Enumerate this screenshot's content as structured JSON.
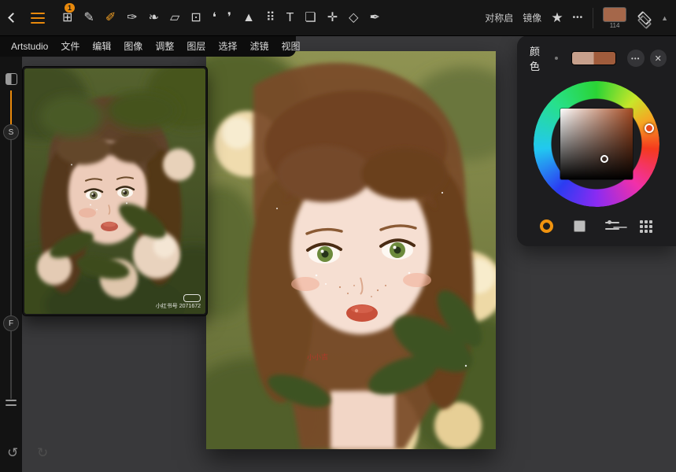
{
  "topbar": {
    "menu_badge": "1",
    "tools": [
      {
        "name": "tools-grid-icon",
        "glyph": "⊞"
      },
      {
        "name": "pencil-set-icon",
        "glyph": "✎"
      },
      {
        "name": "paint-brush-icon",
        "glyph": "✐",
        "active": "true"
      },
      {
        "name": "palette-knife-icon",
        "glyph": "✑"
      },
      {
        "name": "wet-brush-icon",
        "glyph": "❧"
      },
      {
        "name": "eraser-icon",
        "glyph": "▱"
      },
      {
        "name": "crop-icon",
        "glyph": "⊡"
      },
      {
        "name": "water-drop-icon",
        "glyph": "❛"
      },
      {
        "name": "smudge-icon",
        "glyph": "❜"
      },
      {
        "name": "shape-icon",
        "glyph": "▲"
      },
      {
        "name": "airbrush-icon",
        "glyph": "⠿"
      },
      {
        "name": "text-icon",
        "glyph": "T"
      },
      {
        "name": "speech-bubble-icon",
        "glyph": "❏"
      },
      {
        "name": "transform-icon",
        "glyph": "✛"
      },
      {
        "name": "lasso-icon",
        "glyph": "◇"
      },
      {
        "name": "eyedropper-icon",
        "glyph": "✒"
      }
    ],
    "symmetry_label": "对称启",
    "mirror_label": "镜像",
    "swatch_value": "114",
    "swatch_color": "#a5674a"
  },
  "icons": {
    "star": "★",
    "more": "•••",
    "collapse": "▲",
    "undo": "↺",
    "redo": "↻",
    "close": "✕",
    "ellipsis": "•••"
  },
  "menubar": {
    "items": [
      {
        "name": "menu-artstudio",
        "label": "Artstudio"
      },
      {
        "name": "menu-file",
        "label": "文件"
      },
      {
        "name": "menu-edit",
        "label": "编辑"
      },
      {
        "name": "menu-image",
        "label": "图像"
      },
      {
        "name": "menu-adjust",
        "label": "调整"
      },
      {
        "name": "menu-layer",
        "label": "图层"
      },
      {
        "name": "menu-select",
        "label": "选择"
      },
      {
        "name": "menu-filter",
        "label": "滤镜"
      },
      {
        "name": "menu-view",
        "label": "视图"
      }
    ]
  },
  "sidebar": {
    "size_label": "S",
    "flow_label": "F"
  },
  "reference_panel": {
    "watermark": "小红书号 2071672"
  },
  "canvas": {
    "signature": "小小吉"
  },
  "color_panel": {
    "title": "颜色",
    "swatch_left": "#c7a08c",
    "swatch_right": "#a05c3c",
    "accent_orange": "#f0930f",
    "hue_selected": "#a34a22"
  }
}
